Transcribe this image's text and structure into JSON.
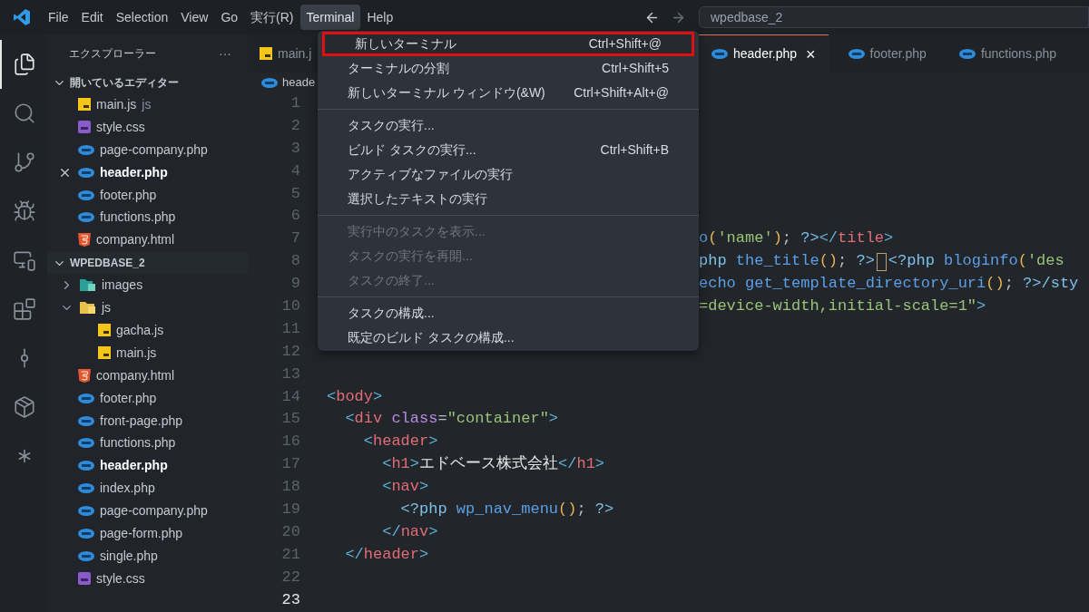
{
  "menubar": {
    "items": [
      {
        "label": "File",
        "selected": false
      },
      {
        "label": "Edit",
        "selected": false
      },
      {
        "label": "Selection",
        "selected": false
      },
      {
        "label": "View",
        "selected": false
      },
      {
        "label": "Go",
        "selected": false
      },
      {
        "label": "実行(R)",
        "selected": false
      },
      {
        "label": "Terminal",
        "selected": true
      },
      {
        "label": "Help",
        "selected": false
      }
    ],
    "back_disabled": false,
    "forward_disabled": true,
    "search": "wpedbase_2"
  },
  "activity_bar": [
    {
      "selected": true
    },
    {
      "selected": false
    },
    {
      "selected": false
    },
    {
      "selected": false
    },
    {
      "selected": false
    },
    {
      "selected": false
    },
    {
      "selected": false
    },
    {
      "selected": false
    },
    {
      "selected": false
    }
  ],
  "sidebar": {
    "title": "エクスプローラー",
    "more": "···",
    "open_editors": {
      "label": "開いているエディター",
      "expanded": true,
      "items": [
        {
          "name": "main.js",
          "kind": "js",
          "hint": "js",
          "selected": false
        },
        {
          "name": "style.css",
          "kind": "css",
          "selected": false
        },
        {
          "name": "page-company.php",
          "kind": "php",
          "selected": false
        },
        {
          "name": "header.php",
          "kind": "php",
          "selected": true
        },
        {
          "name": "footer.php",
          "kind": "php",
          "selected": false
        },
        {
          "name": "functions.php",
          "kind": "php",
          "selected": false
        },
        {
          "name": "company.html",
          "kind": "html",
          "selected": false
        }
      ]
    },
    "project": {
      "label": "WPEDBASE_2",
      "expanded": true,
      "items": [
        {
          "name": "images",
          "kind": "folder-images",
          "expanded": false,
          "selected": false
        },
        {
          "name": "js",
          "kind": "folder-js",
          "expanded": true,
          "selected": false,
          "children": [
            {
              "name": "gacha.js",
              "kind": "js",
              "selected": false
            },
            {
              "name": "main.js",
              "kind": "js",
              "selected": false
            }
          ]
        },
        {
          "name": "company.html",
          "kind": "html",
          "selected": false
        },
        {
          "name": "footer.php",
          "kind": "php",
          "selected": false
        },
        {
          "name": "front-page.php",
          "kind": "php",
          "selected": false
        },
        {
          "name": "functions.php",
          "kind": "php",
          "selected": false
        },
        {
          "name": "header.php",
          "kind": "php",
          "selected": true
        },
        {
          "name": "index.php",
          "kind": "php",
          "selected": false
        },
        {
          "name": "page-company.php",
          "kind": "php",
          "selected": false
        },
        {
          "name": "page-form.php",
          "kind": "php",
          "selected": false
        },
        {
          "name": "single.php",
          "kind": "php",
          "selected": false
        },
        {
          "name": "style.css",
          "kind": "css",
          "selected": false
        }
      ]
    }
  },
  "tabs": [
    {
      "label": "main.j",
      "kind": "js",
      "selected": false
    },
    {
      "label": "header.php",
      "kind": "php",
      "selected": true,
      "close": "×"
    },
    {
      "label": "footer.php",
      "kind": "php",
      "selected": false
    },
    {
      "label": "functions.php",
      "kind": "php",
      "selected": false
    }
  ],
  "breadcrumb": {
    "label": "heade",
    "kind": "php"
  },
  "editor": {
    "lines": [
      {
        "number": "1",
        "current": false
      },
      {
        "number": "2",
        "current": false
      },
      {
        "number": "3",
        "current": false
      },
      {
        "number": "4",
        "current": false
      },
      {
        "number": "5",
        "current": false
      },
      {
        "number": "6",
        "current": false
      },
      {
        "number": "7",
        "current": false,
        "clipped": true,
        "tokens": [
          {
            "kind": "func",
            "text": "o"
          },
          {
            "kind": "paren",
            "text": "("
          },
          {
            "kind": "string",
            "text": "'name'"
          },
          {
            "kind": "paren",
            "text": ")"
          },
          {
            "kind": "punct",
            "text": "; "
          },
          {
            "kind": "php",
            "text": "?>"
          },
          {
            "kind": "bracket",
            "text": "</"
          },
          {
            "kind": "tag",
            "text": "title"
          },
          {
            "kind": "bracket",
            "text": ">"
          }
        ]
      },
      {
        "number": "8",
        "current": false,
        "clipped": true,
        "tokens": [
          {
            "kind": "php",
            "text": "php"
          },
          {
            "kind": "func",
            "text": " the_title"
          },
          {
            "kind": "paren",
            "text": "()"
          },
          {
            "kind": "punct",
            "text": "; "
          },
          {
            "kind": "php",
            "text": "?>"
          },
          {
            "kind": "cursor"
          },
          {
            "kind": "php",
            "text": "<?php"
          },
          {
            "kind": "func",
            "text": " bloginfo"
          },
          {
            "kind": "paren",
            "text": "("
          },
          {
            "kind": "string",
            "text": "'des"
          }
        ]
      },
      {
        "number": "9",
        "current": false,
        "clipped": true,
        "tokens": [
          {
            "kind": "func",
            "text": "echo get_template_directory_uri"
          },
          {
            "kind": "paren",
            "text": "()"
          },
          {
            "kind": "punct",
            "text": "; "
          },
          {
            "kind": "php",
            "text": "?>/sty"
          }
        ]
      },
      {
        "number": "10",
        "current": false,
        "clipped": true,
        "tokens": [
          {
            "kind": "string",
            "text": "=device-width,initial-scale=1\""
          },
          {
            "kind": "bracket",
            "text": ">"
          }
        ]
      },
      {
        "number": "11",
        "current": false
      },
      {
        "number": "12",
        "current": false
      },
      {
        "number": "13",
        "current": false
      },
      {
        "number": "14",
        "current": false,
        "tokens": [
          {
            "kind": "bracket",
            "text": "<"
          },
          {
            "kind": "tag",
            "text": "body"
          },
          {
            "kind": "bracket",
            "text": ">"
          }
        ]
      },
      {
        "number": "15",
        "current": false,
        "tokens": [
          {
            "kind": "bracket",
            "text": "  <"
          },
          {
            "kind": "tag",
            "text": "div"
          },
          {
            "kind": "attr",
            "text": " class"
          },
          {
            "kind": "punct",
            "text": "="
          },
          {
            "kind": "string",
            "text": "\"container\""
          },
          {
            "kind": "bracket",
            "text": ">"
          }
        ]
      },
      {
        "number": "16",
        "current": false,
        "tokens": [
          {
            "kind": "bracket",
            "text": "    <"
          },
          {
            "kind": "tag",
            "text": "header"
          },
          {
            "kind": "bracket",
            "text": ">"
          }
        ]
      },
      {
        "number": "17",
        "current": false,
        "tokens": [
          {
            "kind": "bracket",
            "text": "      <"
          },
          {
            "kind": "tag",
            "text": "h1"
          },
          {
            "kind": "bracket",
            "text": ">"
          },
          {
            "kind": "text",
            "text": "エドベース株式会社"
          },
          {
            "kind": "bracket",
            "text": "</"
          },
          {
            "kind": "tag",
            "text": "h1"
          },
          {
            "kind": "bracket",
            "text": ">"
          }
        ]
      },
      {
        "number": "18",
        "current": false,
        "tokens": [
          {
            "kind": "bracket",
            "text": "      <"
          },
          {
            "kind": "tag",
            "text": "nav"
          },
          {
            "kind": "bracket",
            "text": ">"
          }
        ]
      },
      {
        "number": "19",
        "current": false,
        "tokens": [
          {
            "kind": "php",
            "text": "        <?php"
          },
          {
            "kind": "func",
            "text": " wp_nav_menu"
          },
          {
            "kind": "paren",
            "text": "()"
          },
          {
            "kind": "punct",
            "text": "; "
          },
          {
            "kind": "php",
            "text": "?>"
          }
        ]
      },
      {
        "number": "20",
        "current": false,
        "tokens": [
          {
            "kind": "bracket",
            "text": "      </"
          },
          {
            "kind": "tag",
            "text": "nav"
          },
          {
            "kind": "bracket",
            "text": ">"
          }
        ]
      },
      {
        "number": "21",
        "current": false,
        "tokens": [
          {
            "kind": "bracket",
            "text": "  </"
          },
          {
            "kind": "tag",
            "text": "header"
          },
          {
            "kind": "bracket",
            "text": ">"
          }
        ]
      },
      {
        "number": "22",
        "current": false
      },
      {
        "number": "23",
        "current": true
      }
    ]
  },
  "menu": {
    "groups": [
      [
        {
          "label": "新しいターミナル",
          "shortcut": "Ctrl+Shift+@",
          "selected": true,
          "disabled": false
        },
        {
          "label": "ターミナルの分割",
          "shortcut": "Ctrl+Shift+5",
          "selected": false,
          "disabled": false
        },
        {
          "label": "新しいターミナル ウィンドウ(&W)",
          "shortcut": "Ctrl+Shift+Alt+@",
          "selected": false,
          "disabled": false
        }
      ],
      [
        {
          "label": "タスクの実行...",
          "selected": false,
          "disabled": false
        },
        {
          "label": "ビルド タスクの実行...",
          "shortcut": "Ctrl+Shift+B",
          "selected": false,
          "disabled": false
        },
        {
          "label": "アクティブなファイルの実行",
          "selected": false,
          "disabled": false
        },
        {
          "label": "選択したテキストの実行",
          "selected": false,
          "disabled": false
        }
      ],
      [
        {
          "label": "実行中のタスクを表示...",
          "selected": false,
          "disabled": true
        },
        {
          "label": "タスクの実行を再開...",
          "selected": false,
          "disabled": true
        },
        {
          "label": "タスクの終了...",
          "selected": false,
          "disabled": true
        }
      ],
      [
        {
          "label": "タスクの構成...",
          "selected": false,
          "disabled": false
        },
        {
          "label": "既定のビルド タスクの構成...",
          "selected": false,
          "disabled": false
        }
      ]
    ]
  }
}
